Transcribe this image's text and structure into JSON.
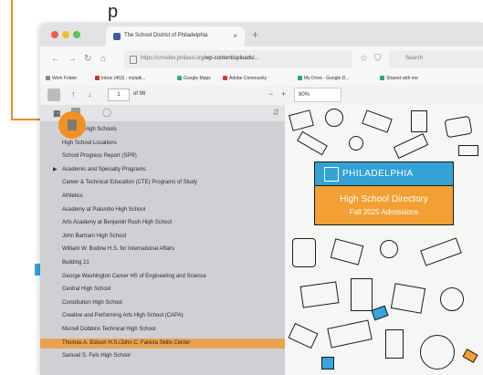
{
  "annotation": {
    "top_label": "p",
    "accent_color": "#ef8a1d"
  },
  "browser": {
    "tab_title": "The School District of Philadelphia",
    "tab_close": "×",
    "new_tab": "+",
    "url_host": "https://cmsdev.philasd.org",
    "url_path": "/wp-content/uploads/...",
    "search_placeholder": "Search",
    "bookmarks": [
      "Work Folder",
      "Inbox (453) - mytalk...",
      "Google Maps",
      "Adobe Community",
      "My Drive - Google D...",
      "Shared with me"
    ]
  },
  "pdf_toolbar": {
    "page_current": "1",
    "page_total": "of 96",
    "zoom": "80%",
    "zoom_minus": "−",
    "zoom_plus": "+"
  },
  "sidebar": {
    "outline": [
      {
        "label": "Types of High Schools",
        "selected": false,
        "expander": false
      },
      {
        "label": "High School Locations",
        "selected": false,
        "expander": false
      },
      {
        "label": "School Progress Report (SPR)",
        "selected": false,
        "expander": false
      },
      {
        "label": "Academic and Specialty Programs",
        "selected": false,
        "expander": true
      },
      {
        "label": "Career & Technical Education (CTE) Programs of Study",
        "selected": false,
        "expander": false
      },
      {
        "label": "Athletics",
        "selected": false,
        "expander": false
      },
      {
        "label": "Academy at Palumbo High School",
        "selected": false,
        "expander": false
      },
      {
        "label": "Arts Academy at Benjamin Rush High School",
        "selected": false,
        "expander": false
      },
      {
        "label": "John Bartram High School",
        "selected": false,
        "expander": false
      },
      {
        "label": "William W. Bodine H.S. for International Affairs",
        "selected": false,
        "expander": false
      },
      {
        "label": "Building 21",
        "selected": false,
        "expander": false
      },
      {
        "label": "George Washington Carver HS of Engineering and Science",
        "selected": false,
        "expander": false
      },
      {
        "label": "Central High School",
        "selected": false,
        "expander": false
      },
      {
        "label": "Constitution High School",
        "selected": false,
        "expander": false
      },
      {
        "label": "Creative and Performing Arts High School (CAPA)",
        "selected": false,
        "expander": false
      },
      {
        "label": "Murrell Dobbins Technical High School",
        "selected": false,
        "expander": false
      },
      {
        "label": "Thomas A. Edison H.S./John C. Fareira Skills Center",
        "selected": true,
        "expander": false
      },
      {
        "label": "Samuel S. Fels High School",
        "selected": false,
        "expander": false
      }
    ]
  },
  "cover": {
    "brand": "PHILADELPHIA",
    "title": "High School Directory",
    "subtitle": "Fall 2025 Admissions",
    "blue": "#34a2d6",
    "orange": "#f2a033"
  }
}
